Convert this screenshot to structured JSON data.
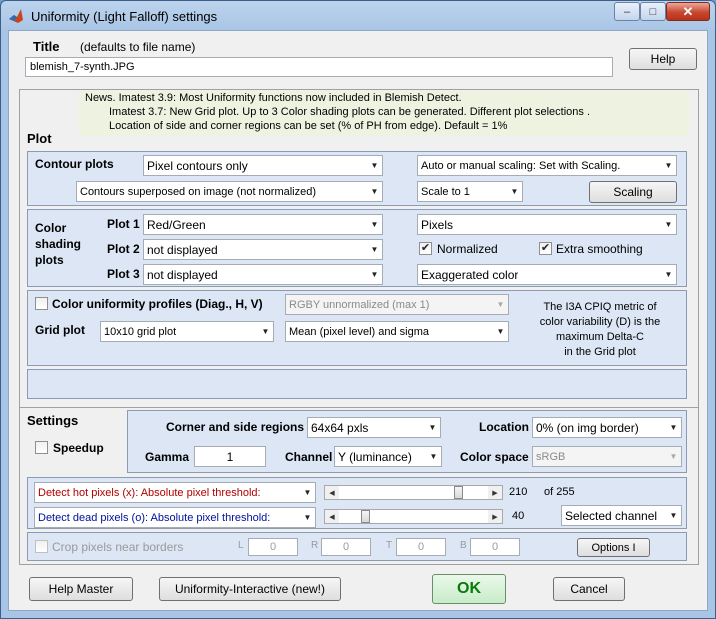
{
  "window": {
    "title": "Uniformity (Light Falloff) settings",
    "icon": "matlab-logo-icon",
    "controls": {
      "minimize": "–",
      "maximize": "□",
      "close": "✕"
    }
  },
  "header": {
    "title_label": "Title",
    "title_hint": "(defaults to file name)",
    "title_value": "blemish_7-synth.JPG",
    "help_button": "Help"
  },
  "plot": {
    "section_label": "Plot",
    "news": [
      "News. Imatest 3.9:  Most Uniformity functions now included in Blemish Detect.",
      "Imatest 3.7: New Grid plot.  Up to 3 Color shading plots can be generated.  Different plot selections .",
      "Location of side and corner regions can be set (% of PH from edge). Default = 1%"
    ],
    "contour": {
      "label": "Contour plots",
      "type": "Pixel contours only",
      "overlay": "Contours superposed on image (not normalized)",
      "scaling_mode": "Auto or manual scaling: Set with Scaling.",
      "scale": "Scale to 1",
      "scaling_button": "Scaling"
    },
    "color_shading": {
      "label_lines": [
        "Color",
        "shading",
        "plots"
      ],
      "plot1_label": "Plot 1",
      "plot1_value": "Red/Green",
      "plot2_label": "Plot 2",
      "plot2_value": "not displayed",
      "plot3_label": "Plot 3",
      "plot3_value": "not displayed",
      "units": "Pixels",
      "normalized_label": "Normalized",
      "normalized_checked": true,
      "extra_smoothing_label": "Extra smoothing",
      "extra_smoothing_checked": true,
      "color_mode": "Exaggerated color"
    },
    "uniformity": {
      "profiles_label": "Color uniformity profiles (Diag., H, V)",
      "profiles_checked": false,
      "profile_type": "RGBY unnormalized (max 1)",
      "grid_label": "Grid plot",
      "grid_value": "10x10 grid plot",
      "grid_stat": "Mean (pixel level) and sigma",
      "note": [
        "The I3A CPIQ metric of",
        "color variability (D) is the",
        "maximum Delta-C",
        "in the Grid plot"
      ]
    }
  },
  "settings": {
    "label": "Settings",
    "speedup_label": "Speedup",
    "speedup_checked": false,
    "regions_label": "Corner and side regions",
    "regions_value": "64x64 pxls",
    "location_label": "Location",
    "location_value": "0% (on img border)",
    "gamma_label": "Gamma",
    "gamma_value": "1",
    "channel_label": "Channel",
    "channel_value": "Y (luminance)",
    "colorspace_label": "Color space",
    "colorspace_value": "sRGB",
    "hot": {
      "select": "Detect hot pixels (x):  Absolute pixel threshold:",
      "value": "210",
      "max_label": "of 255",
      "level": 0.82
    },
    "dead": {
      "select": "Detect dead pixels (o):  Absolute pixel threshold:",
      "value": "40",
      "level": 0.16,
      "channel": "Selected channel"
    },
    "crop": {
      "label": "Crop pixels near borders",
      "checked": false,
      "L_label": "L",
      "L_value": "0",
      "R_label": "R",
      "R_value": "0",
      "T_label": "T",
      "T_value": "0",
      "B_label": "B",
      "B_value": "0",
      "options_button": "Options I"
    }
  },
  "footer": {
    "help_master": "Help Master",
    "interactive": "Uniformity-Interactive (new!)",
    "ok": "OK",
    "cancel": "Cancel"
  }
}
